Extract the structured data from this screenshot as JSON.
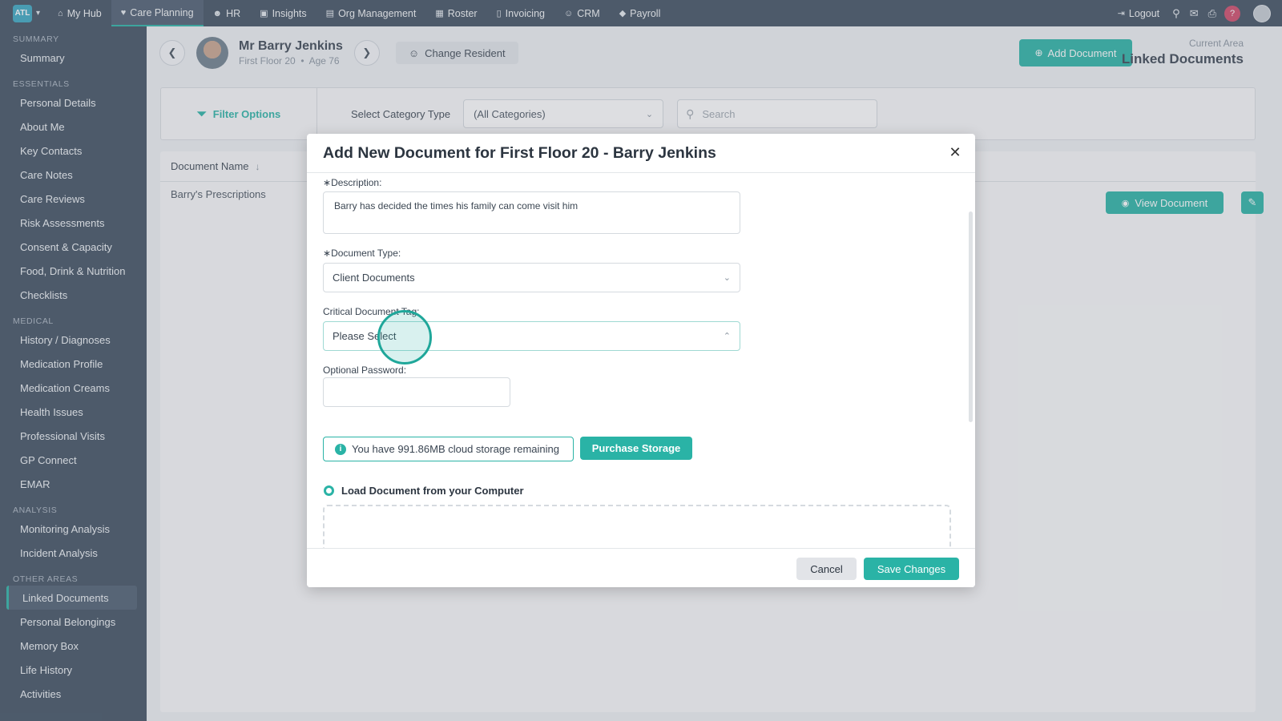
{
  "topnav": {
    "logo": "ATL",
    "items": [
      {
        "icon": "home-icon",
        "label": "My Hub"
      },
      {
        "icon": "heart-icon",
        "label": "Care Planning"
      },
      {
        "icon": "people-icon",
        "label": "HR"
      },
      {
        "icon": "insights-icon",
        "label": "Insights"
      },
      {
        "icon": "building-icon",
        "label": "Org Management"
      },
      {
        "icon": "calendar-icon",
        "label": "Roster"
      },
      {
        "icon": "invoice-icon",
        "label": "Invoicing"
      },
      {
        "icon": "user-icon",
        "label": "CRM"
      },
      {
        "icon": "tag-icon",
        "label": "Payroll"
      }
    ],
    "logout": "Logout",
    "help": "?"
  },
  "sidebar": {
    "sections": [
      {
        "title": "SUMMARY",
        "items": [
          "Summary"
        ]
      },
      {
        "title": "ESSENTIALS",
        "items": [
          "Personal Details",
          "About Me",
          "Key Contacts",
          "Care Notes",
          "Care Reviews",
          "Risk Assessments",
          "Consent & Capacity",
          "Food, Drink & Nutrition",
          "Checklists"
        ]
      },
      {
        "title": "MEDICAL",
        "items": [
          "History / Diagnoses",
          "Medication Profile",
          "Medication Creams",
          "Health Issues",
          "Professional Visits",
          "GP Connect",
          "EMAR"
        ]
      },
      {
        "title": "ANALYSIS",
        "items": [
          "Monitoring Analysis",
          "Incident Analysis"
        ]
      },
      {
        "title": "OTHER AREAS",
        "items": [
          "Linked Documents",
          "Personal Belongings",
          "Memory Box",
          "Life History",
          "Activities"
        ]
      }
    ],
    "active": "Linked Documents"
  },
  "header": {
    "resident_name": "Mr Barry Jenkins",
    "resident_location": "First Floor 20",
    "resident_age": "Age 76",
    "change_resident": "Change Resident",
    "add_document": "Add Document",
    "current_area_label": "Current Area",
    "current_area_value": "Linked Documents"
  },
  "filters": {
    "filter_options": "Filter Options",
    "category_label": "Select Category Type",
    "category_value": "(All Categories)",
    "search_placeholder": "Search"
  },
  "table": {
    "column_header": "Document Name",
    "rows": [
      {
        "name": "Barry's Prescriptions",
        "action": "View Document"
      }
    ]
  },
  "modal": {
    "title": "Add New Document for First Floor 20 - Barry Jenkins",
    "description_label": "Description:",
    "description_value": "Barry has decided the times his family can come visit him",
    "doc_type_label": "Document Type:",
    "doc_type_value": "Client Documents",
    "critical_tag_label": "Critical Document Tag:",
    "critical_tag_value": "Please Select",
    "password_label": "Optional Password:",
    "storage_text": "You have 991.86MB cloud storage remaining",
    "purchase_storage": "Purchase Storage",
    "load_option": "Load Document from your Computer",
    "cancel": "Cancel",
    "save": "Save Changes"
  },
  "colors": {
    "accent": "#2ab3a6",
    "nav_bg": "#3f4f61"
  }
}
